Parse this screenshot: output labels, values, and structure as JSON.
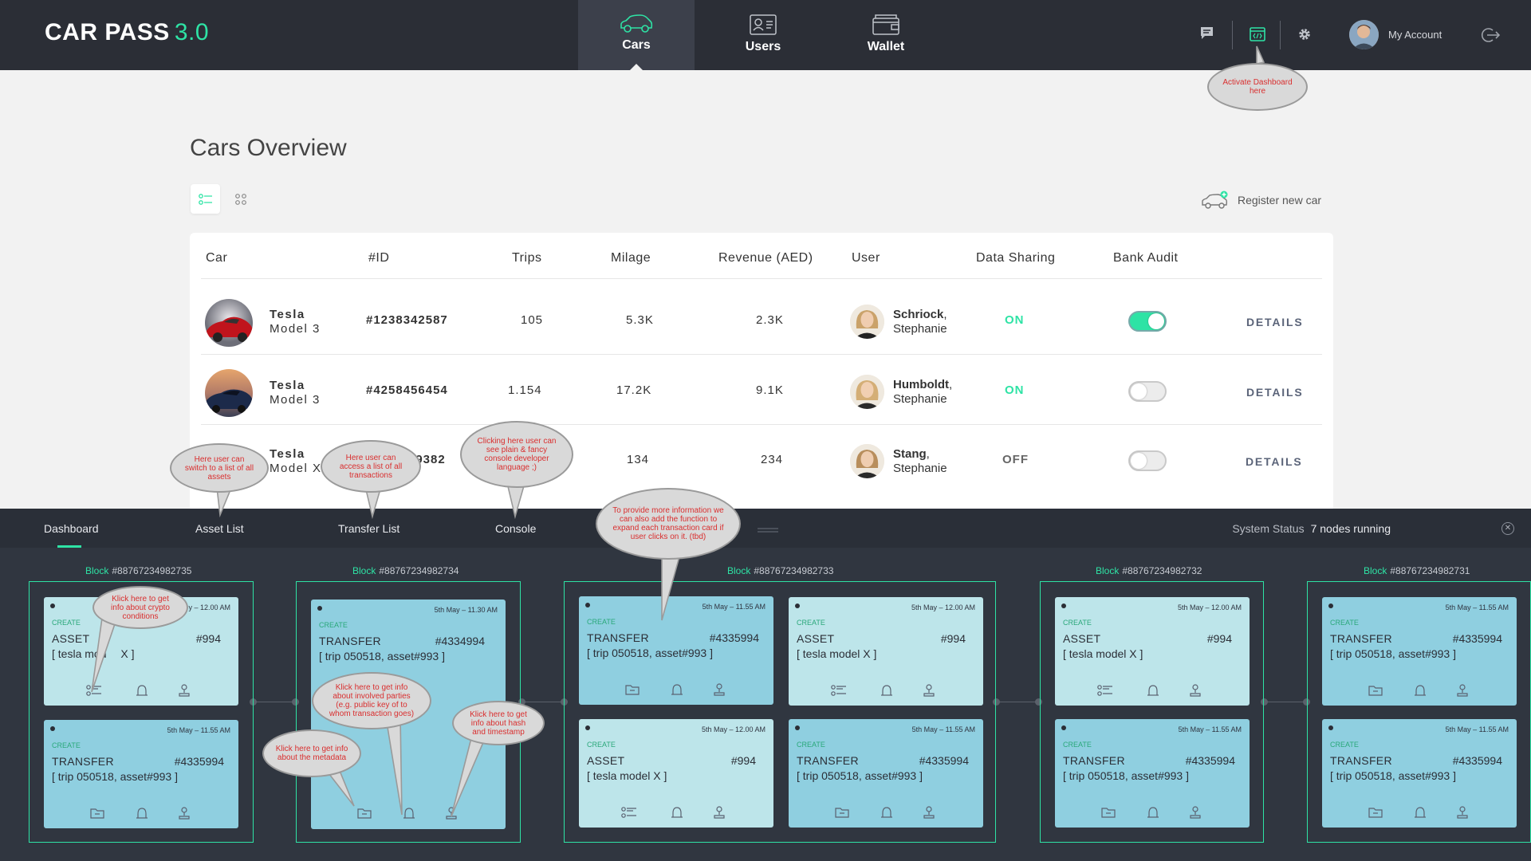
{
  "app": {
    "brand": "CAR PASS",
    "version": "3.0"
  },
  "nav": {
    "tabs": [
      {
        "label": "Cars"
      },
      {
        "label": "Users"
      },
      {
        "label": "Wallet"
      }
    ],
    "active": "Cars"
  },
  "topbar": {
    "account_label": "My Account",
    "icons": [
      "chat-icon",
      "dashboard-console-icon",
      "gear-icon",
      "avatar",
      "logout-icon"
    ]
  },
  "page": {
    "title": "Cars Overview",
    "register_label": "Register new car",
    "view_modes": [
      "list-view-icon",
      "grid-view-icon"
    ]
  },
  "table": {
    "headers": [
      "Car",
      "#ID",
      "Trips",
      "Milage",
      "Revenue (AED)",
      "User",
      "Data Sharing",
      "Bank Audit"
    ],
    "rows": [
      {
        "make": "Tesla",
        "model": "Model 3",
        "id": "#1238342587",
        "trips": "105",
        "milage": "5.3K",
        "revenue": "2.3K",
        "user_last": "Schriock",
        "user_first": "Stephanie",
        "data_sharing": "ON",
        "bank_audit": true,
        "details": "DETAILS"
      },
      {
        "make": "Tesla",
        "model": "Model 3",
        "id": "#4258456454",
        "trips": "1.154",
        "milage": "17.2K",
        "revenue": "9.1K",
        "user_last": "Humboldt",
        "user_first": "Stephanie",
        "data_sharing": "ON",
        "bank_audit": false,
        "details": "DETAILS"
      },
      {
        "make": "Tesla",
        "model": "Model X",
        "id": "59382",
        "trips": "",
        "milage": "134",
        "revenue": "234",
        "user_last": "Stang",
        "user_first": "Stephanie",
        "data_sharing": "OFF",
        "bank_audit": false,
        "details": "DETAILS"
      }
    ]
  },
  "dashboard": {
    "tabs": [
      "Dashboard",
      "Asset List",
      "Transfer List",
      "Console"
    ],
    "active_tab": "Dashboard",
    "status_label": "System Status",
    "status_value": "7 nodes running",
    "blocks": [
      {
        "label": "Block",
        "hash": "#88767234982735"
      },
      {
        "label": "Block",
        "hash": "#88767234982734"
      },
      {
        "label": "Block",
        "hash": "#88767234982733"
      },
      {
        "label": "Block",
        "hash": "#88767234982732"
      },
      {
        "label": "Block",
        "hash": "#88767234982731"
      }
    ],
    "tx": {
      "a1": {
        "kind": "CREATE",
        "title": "ASSET",
        "num": "#994",
        "sub": "[ tesla model X ]",
        "date": "5th May – 12.00 AM"
      },
      "a1_sub_visible": "[ tesla mod",
      "a1_sub_tail": "X ]",
      "t1": {
        "kind": "CREATE",
        "title": "TRANSFER",
        "num": "#4335994",
        "sub": "[ trip 050518, asset#993 ]",
        "date": "5th May – 11.55 AM"
      },
      "t2": {
        "kind": "CREATE",
        "title": "TRANSFER",
        "num": "#4334994",
        "sub": "[ trip 050518, asset#993 ]",
        "date": "5th May – 11.30 AM"
      },
      "t3": {
        "kind": "CREATE",
        "title": "TRANSFER",
        "num": "#4335994",
        "sub": "[ trip 050518, asset#993 ]",
        "date": "5th May – 11.55 AM"
      },
      "a2": {
        "kind": "CREATE",
        "title": "ASSET",
        "num": "#994",
        "sub": "[ tesla model X ]",
        "date": "5th May – 12.00 AM"
      },
      "date_partial": "y – 12.00 AM"
    }
  },
  "annotations": {
    "activate": "Activate Dashboard here",
    "asset_list": "Here user can switch to a list of all assets",
    "transfer_list": "Here user can access a list of all transactions",
    "console": "Clicking here user can see plain & fancy console developer language ;)",
    "expand": "To provide more information we can also add the function to expand each transaction card if user clicks on it. (tbd)",
    "crypto": "Klick here to get info about crypto conditions",
    "parties": "Klick here to get info about involved parties (e.g. public key of to whom transaction goes)",
    "metadata": "Klick here to get info about the metadata",
    "hash": "Klick here to get info about hash and timestamp"
  },
  "colors": {
    "accent": "#2ee3a5",
    "topbar": "#2b2e36",
    "dash_bg": "#303640",
    "asset_card": "#bde5ea",
    "transfer_card": "#8fcfe0",
    "details": "#5b6479",
    "bubble_text": "#d92f2f"
  }
}
